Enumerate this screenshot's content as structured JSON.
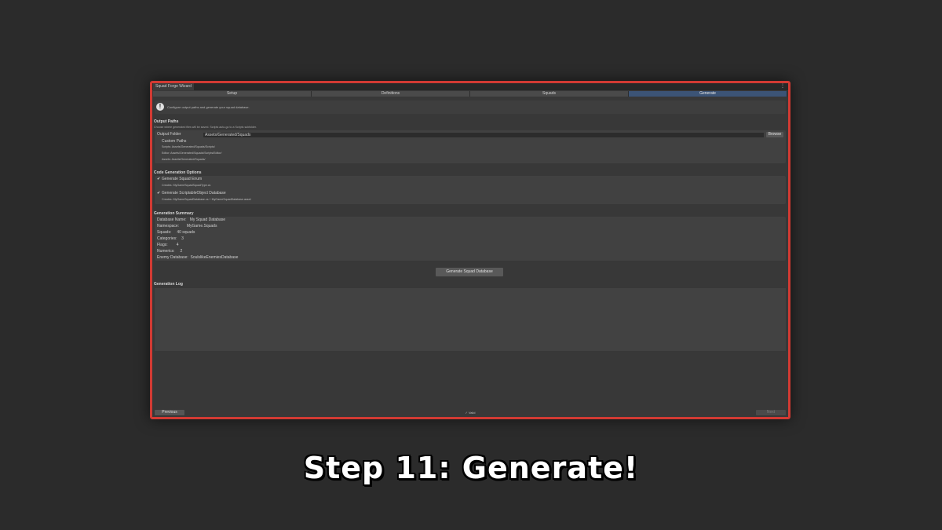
{
  "window": {
    "title": "Squad Forge Wizard",
    "menu_glyph": "⋮"
  },
  "tabs": [
    {
      "label": "Setup"
    },
    {
      "label": "Definitions"
    },
    {
      "label": "Squads"
    },
    {
      "label": "Generate"
    }
  ],
  "info": {
    "text": "Configure output paths and generate your squad database."
  },
  "output_paths": {
    "title": "Output Paths",
    "subtitle": "Choose where generated files will be saved. Scripts auto-go to a Scripts subfolder.",
    "output_folder_label": "Output Folder",
    "output_folder_value": "Assets/Generated/Squads",
    "browse_label": "Browse",
    "custom_paths_label": "Custom Paths",
    "scripts": "Scripts:  Assets/Generated/Squads/Scripts/",
    "editor": "Editor:  Assets/Generated/Squads/Scripts/Editor/",
    "assets": "Assets:  Assets/Generated/Squads/"
  },
  "code_gen": {
    "title": "Code Generation Options",
    "check_glyph": "✔",
    "enum_label": "Generate Squad Enum",
    "enum_creates": "Creates: MyGameSquadSquadType.cs",
    "db_label": "Generate ScriptableObject Database",
    "db_creates": "Creates: MyGameSquadDatabase.cs + MyGameSquadDatabase.asset"
  },
  "summary": {
    "title": "Generation Summary",
    "rows": [
      {
        "label": "Database Name:",
        "value": "My Squad Database"
      },
      {
        "label": "Namespace:",
        "value": "MyGame.Squads"
      },
      {
        "label": "Squads:",
        "value": "40 squads"
      },
      {
        "label": "Categories:",
        "value": "3"
      },
      {
        "label": "Flags:",
        "value": "4"
      },
      {
        "label": "Numerics:",
        "value": "2"
      },
      {
        "label": "Enemy Database:",
        "value": "SoulslikeEnemiesDatabase"
      }
    ]
  },
  "generate_button": "Generate Squad Database",
  "log": {
    "title": "Generation Log"
  },
  "footer": {
    "previous": "Previous",
    "status": "✓ Valid",
    "next": "Next"
  },
  "caption": "Step 11: Generate!",
  "colors": {
    "border": "#d23a33",
    "active_tab": "#3c5476",
    "background": "#2b2b2b"
  }
}
